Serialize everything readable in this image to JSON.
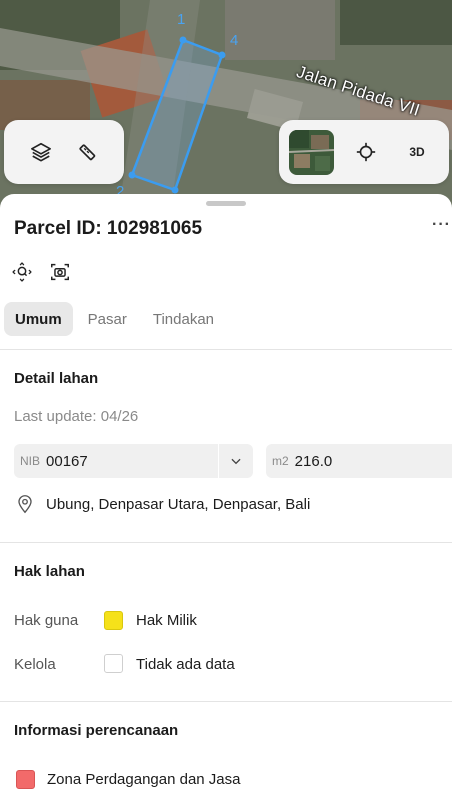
{
  "map": {
    "road_label": "Jalan Pidada VII",
    "vertex_labels": [
      "1",
      "4",
      "2"
    ],
    "parcel_outline_color": "#3b9cf0",
    "left_controls": [
      {
        "icon": "layers-icon"
      },
      {
        "icon": "measure-icon"
      }
    ],
    "right_controls": [
      {
        "icon": "satellite-thumbnail"
      },
      {
        "icon": "locate-icon"
      },
      {
        "label": "3D"
      }
    ]
  },
  "sheet": {
    "title": "Parcel ID: 102981065",
    "more_label": "···",
    "tools": [
      {
        "icon": "zoom-to-parcel-icon"
      },
      {
        "icon": "camera-icon"
      }
    ],
    "tabs": [
      "Umum",
      "Pasar",
      "Tindakan"
    ],
    "active_tab": "Umum",
    "detail": {
      "title": "Detail lahan",
      "last_update": "Last update: 04/26",
      "nib_label": "NIB",
      "nib_value": "00167",
      "area_unit": "m2",
      "area_value": "216.0",
      "location": "Ubung, Denpasar Utara, Denpasar, Bali"
    },
    "rights": {
      "title": "Hak lahan",
      "rows": [
        {
          "label": "Hak guna",
          "value": "Hak Milik",
          "color": "#f5e11a"
        },
        {
          "label": "Kelola",
          "value": "Tidak ada data",
          "color": "#ffffff"
        }
      ]
    },
    "planning": {
      "title": "Informasi perencanaan",
      "zone": "Zona Perdagangan dan Jasa",
      "zone_color": "#f26a6a"
    }
  }
}
